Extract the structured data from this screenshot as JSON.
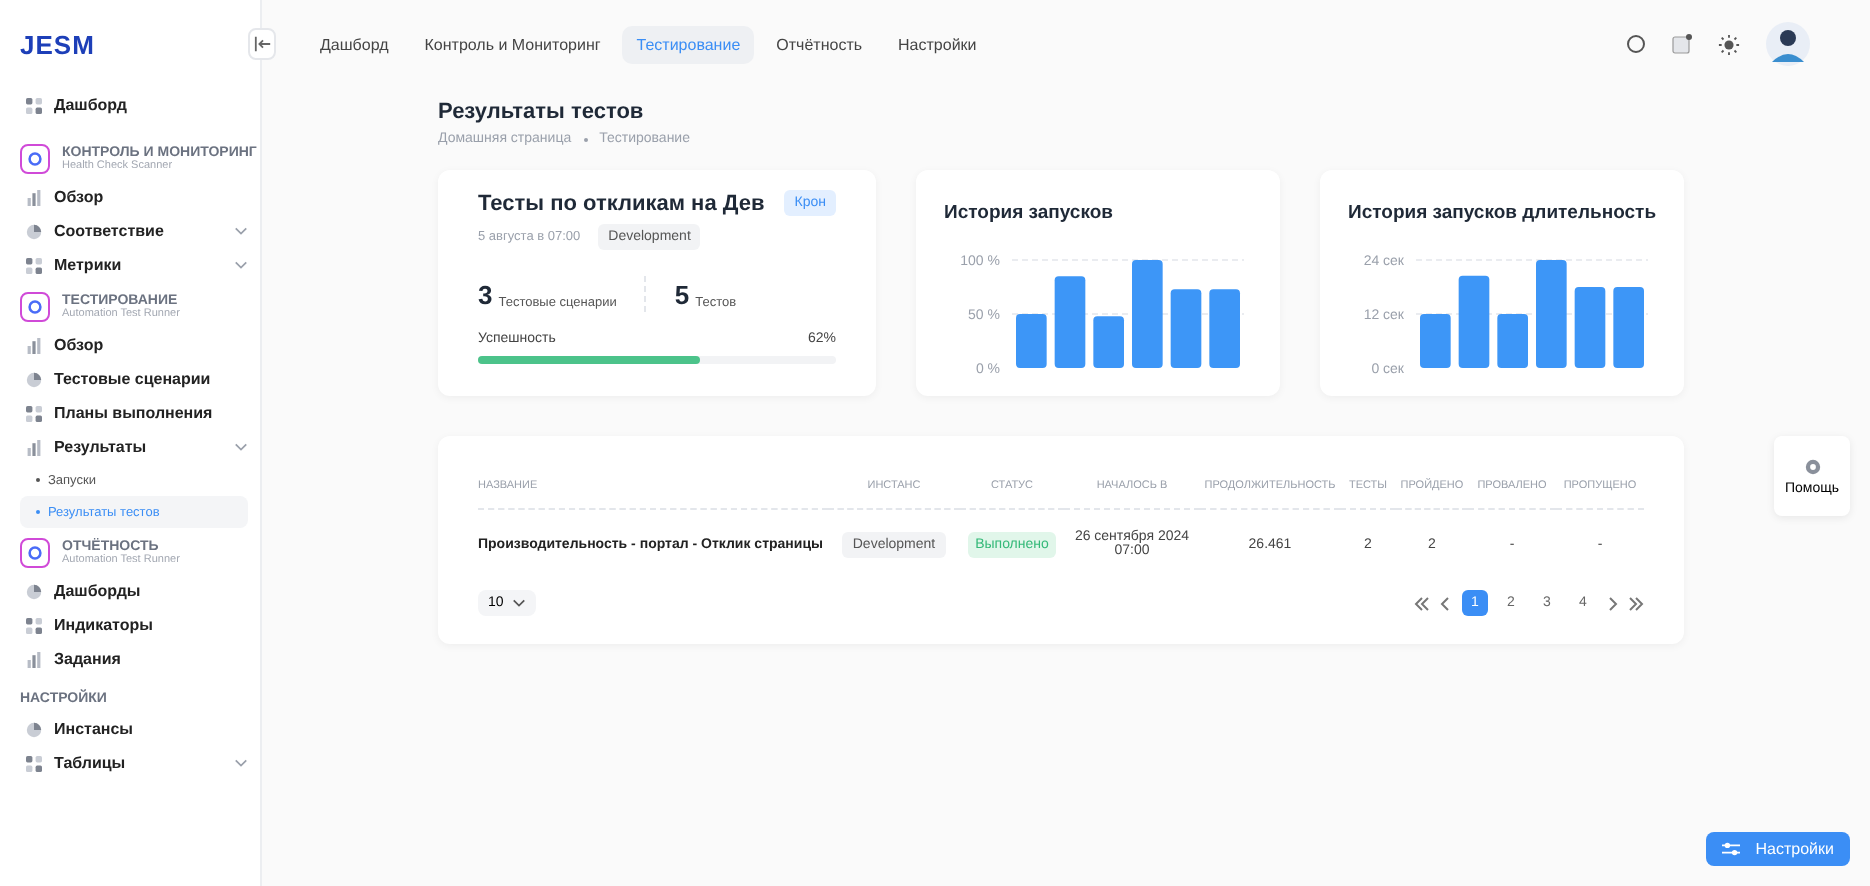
{
  "logo": "JESM",
  "sidebar": {
    "items": [
      {
        "kind": "link",
        "label": "Дашборд"
      },
      {
        "kind": "section",
        "title": "КОНТРОЛЬ И МОНИТОРИНГ",
        "subtitle": "Health Check Scanner",
        "items": [
          {
            "label": "Обзор",
            "expandable": false
          },
          {
            "label": "Соответствие",
            "expandable": true
          },
          {
            "label": "Метрики",
            "expandable": true
          }
        ]
      },
      {
        "kind": "section",
        "title": "ТЕСТИРОВАНИЕ",
        "subtitle": "Automation Test Runner",
        "items": [
          {
            "label": "Обзор",
            "expandable": false
          },
          {
            "label": "Тестовые сценарии",
            "expandable": false
          },
          {
            "label": "Планы выполнения",
            "expandable": false
          },
          {
            "label": "Результаты",
            "expandable": true,
            "children": [
              {
                "label": "Запуски",
                "selected": false
              },
              {
                "label": "Результаты тестов",
                "selected": true
              }
            ]
          }
        ]
      },
      {
        "kind": "section",
        "title": "ОТЧЁТНОСТЬ",
        "subtitle": "Automation Test Runner",
        "items": [
          {
            "label": "Дашборды",
            "expandable": false
          },
          {
            "label": "Индикаторы",
            "expandable": false
          },
          {
            "label": "Задания",
            "expandable": false
          }
        ]
      },
      {
        "kind": "group",
        "title": "НАСТРОЙКИ",
        "items": [
          {
            "label": "Инстансы",
            "expandable": false
          },
          {
            "label": "Таблицы",
            "expandable": true
          }
        ]
      }
    ]
  },
  "tabs": [
    {
      "label": "Дашборд",
      "selected": false
    },
    {
      "label": "Контроль и Мониторинг",
      "selected": false
    },
    {
      "label": "Тестирование",
      "selected": true
    },
    {
      "label": "Отчётность",
      "selected": false
    },
    {
      "label": "Настройки",
      "selected": false
    }
  ],
  "page": {
    "title": "Результаты тестов",
    "breadcrumbs": [
      "Домашняя страница",
      "Тестирование"
    ]
  },
  "summary": {
    "title": "Тесты по откликам на Дев",
    "badge": "Крон",
    "date": "5 августа в 07:00",
    "instance": "Development",
    "stats": [
      {
        "value": "3",
        "label": "Тестовые сценарии"
      },
      {
        "value": "5",
        "label": "Тестов"
      }
    ],
    "success": {
      "label": "Успешность",
      "reading": "62%",
      "level": 0.62
    }
  },
  "charts": [
    {
      "title": "История запусков",
      "chart_data": {
        "type": "bar",
        "values": [
          50,
          85,
          48,
          100,
          73,
          73
        ],
        "ylim": [
          0,
          100
        ],
        "yticks": [
          {
            "value": 0,
            "label": "0 %"
          },
          {
            "value": 50,
            "label": "50 %"
          },
          {
            "value": 100,
            "label": "100 %"
          }
        ]
      }
    },
    {
      "title": "История запусков длительность",
      "chart_data": {
        "type": "bar",
        "values": [
          12,
          20.5,
          12,
          24,
          18,
          18
        ],
        "ylim": [
          0,
          24
        ],
        "yticks": [
          {
            "value": 0,
            "label": "0 сек"
          },
          {
            "value": 12,
            "label": "12 сек"
          },
          {
            "value": 24,
            "label": "24 сек"
          }
        ]
      }
    }
  ],
  "table": {
    "columns": [
      "НАЗВАНИЕ",
      "ИНСТАНС",
      "СТАТУС",
      "НАЧАЛОСЬ В",
      "ПРОДОЛЖИТЕЛЬНОСТЬ",
      "ТЕСТЫ",
      "ПРОЙДЕНО",
      "ПРОВАЛЕНО",
      "ПРОПУЩЕНО"
    ],
    "rows": [
      {
        "name": "Производительность - портал - Отклик страницы",
        "instance": "Development",
        "status": "Выполнено",
        "started": "26 сентября 2024 07:00",
        "duration": "26.461",
        "tests": "2",
        "passed": "2",
        "failed": "-",
        "skipped": "-"
      }
    ],
    "page_size": "10",
    "pages": [
      {
        "label": "1",
        "selected": true
      },
      {
        "label": "2",
        "selected": false
      },
      {
        "label": "3",
        "selected": false
      },
      {
        "label": "4",
        "selected": false
      }
    ]
  },
  "help": {
    "label": "Помощь"
  },
  "settings_button": {
    "label": "Настройки"
  }
}
